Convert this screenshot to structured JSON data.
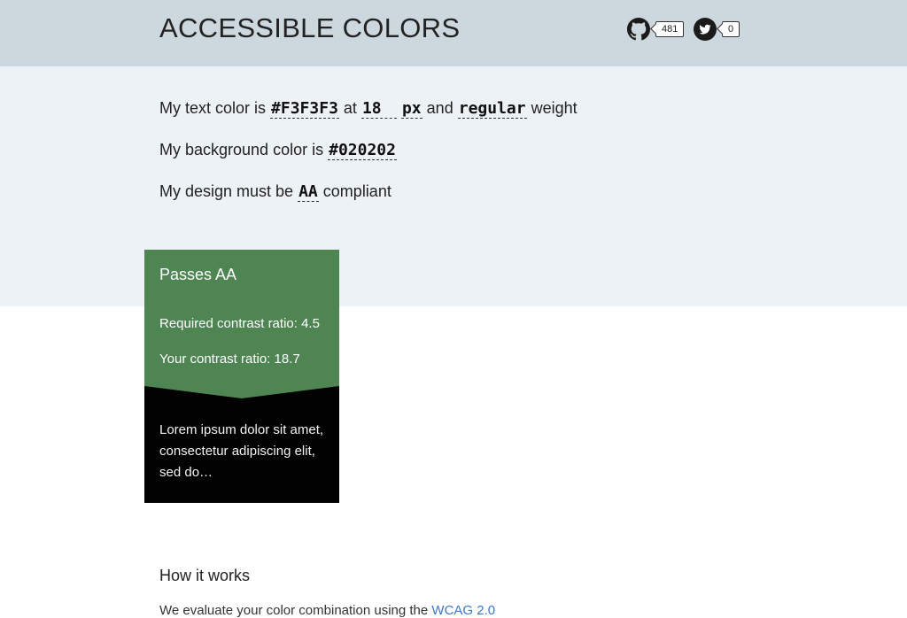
{
  "header": {
    "title": "ACCESSIBLE COLORS",
    "github": {
      "icon": "github-icon",
      "count": "481"
    },
    "twitter": {
      "icon": "twitter-icon",
      "count": "0"
    }
  },
  "form": {
    "line1": {
      "prefix": "My text color is",
      "text_color": "#F3F3F3",
      "at": "at",
      "size": "18",
      "unit": "px",
      "and": "and",
      "weight": "regular",
      "suffix": "weight"
    },
    "line2": {
      "prefix": "My background color is",
      "bg_color": "#020202"
    },
    "line3": {
      "prefix": "My design must be",
      "level": "AA",
      "suffix": "compliant"
    }
  },
  "result": {
    "title": "Passes AA",
    "required": "Required contrast ratio: 4.5",
    "yours": "Your contrast ratio: 18.7",
    "sample_text": "Lorem ipsum dolor sit amet, consectetur adipiscing elit, sed do…"
  },
  "how": {
    "title": "How it works",
    "text": "We evaluate your color combination using the",
    "link": "WCAG 2.0"
  },
  "colors": {
    "header_bg": "#CDD7DE",
    "form_bg": "#EDF2F6",
    "pass_green": "#4F8453",
    "sample_bg": "#020202",
    "sample_text": "#F3F3F3",
    "link": "#3B78C4"
  }
}
